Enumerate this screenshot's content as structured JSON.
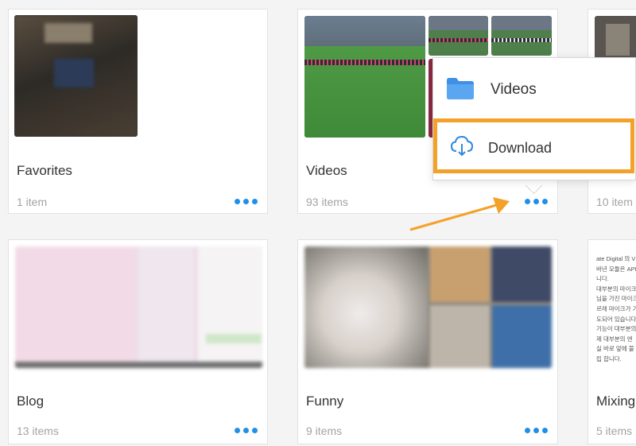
{
  "albums": [
    {
      "title": "Favorites",
      "count": "1 item"
    },
    {
      "title": "Videos",
      "count": "93 items"
    },
    {
      "title": "",
      "count": "10 item"
    },
    {
      "title": "Blog",
      "count": "13 items"
    },
    {
      "title": "Funny",
      "count": "9 items"
    },
    {
      "title": "Mixing",
      "count": "5 items"
    }
  ],
  "menu": {
    "folder_label": "Videos",
    "download_label": "Download"
  },
  "doc_preview_lines": [
    "ate Digital 의 V",
    "바년 모듈은 API E",
    "니다.",
    "대부분의 마이크를",
    "님을 가진 마이크를",
    "르래 마이크가 기",
    "도되어 있습니다",
    "기능이 대부분의",
    "제 대부분의 엔",
    "실 바로 앞에 불",
    "립 합니다."
  ],
  "colors": {
    "accent": "#1f8fe8",
    "highlight": "#f4a12a"
  }
}
